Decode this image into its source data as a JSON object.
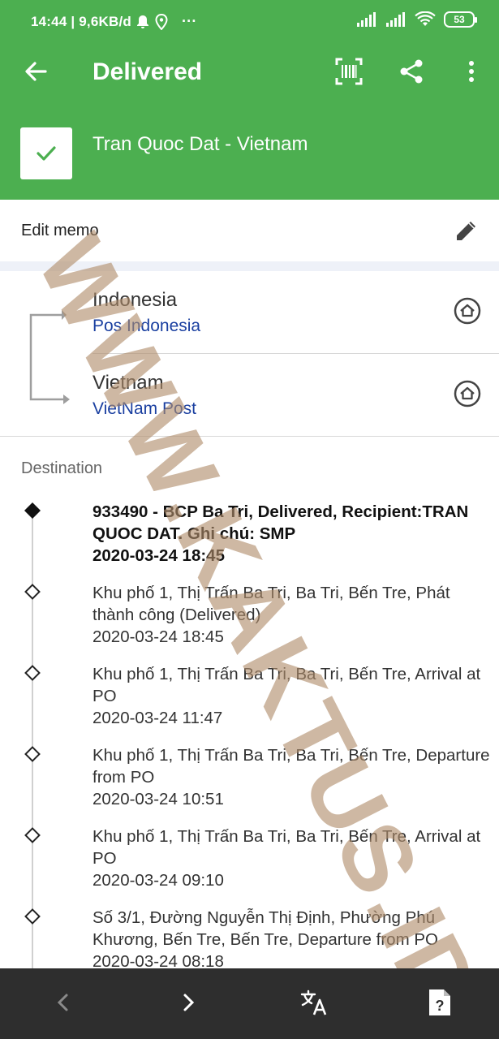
{
  "status_bar": {
    "time_info": "14:44 | 9,6KB/d",
    "extras": "···",
    "battery": "53"
  },
  "toolbar": {
    "title": "Delivered"
  },
  "shipment": {
    "title": "Tran Quoc Dat - Vietnam"
  },
  "memo": {
    "label": "Edit memo"
  },
  "route": {
    "origin": {
      "country": "Indonesia",
      "carrier": "Pos Indonesia"
    },
    "destination": {
      "country": "Vietnam",
      "carrier": "VietNam Post"
    }
  },
  "section_label": "Destination",
  "events": [
    {
      "text": "933490 - BCP Ba Tri, Delivered, Recipient:TRAN QUOC DAT. Ghi chú: SMP",
      "time": "2020-03-24 18:45"
    },
    {
      "text": "Khu phố 1, Thị Trấn Ba Tri, Ba Tri, Bến Tre, Phát thành công (Delivered)",
      "time": "2020-03-24 18:45"
    },
    {
      "text": "Khu phố 1, Thị Trấn Ba Tri, Ba Tri, Bến Tre, Arrival at PO",
      "time": "2020-03-24 11:47"
    },
    {
      "text": "Khu phố 1, Thị Trấn Ba Tri, Ba Tri, Bến Tre, Departure from PO",
      "time": "2020-03-24 10:51"
    },
    {
      "text": "Khu phố 1, Thị Trấn Ba Tri, Ba Tri, Bến Tre, Arrival at PO",
      "time": "2020-03-24 09:10"
    },
    {
      "text": "Số 3/1, Đường Nguyễn Thị Định, Phường Phú Khương, Bến Tre, Bến Tre, Departure from PO",
      "time": "2020-03-24 08:18"
    }
  ],
  "watermark": "WWW.KAKTUS.ID",
  "colors": {
    "primary": "#4caf50",
    "carrier_text": "#1a3fa0",
    "nav_bar": "#2e2e2e"
  }
}
